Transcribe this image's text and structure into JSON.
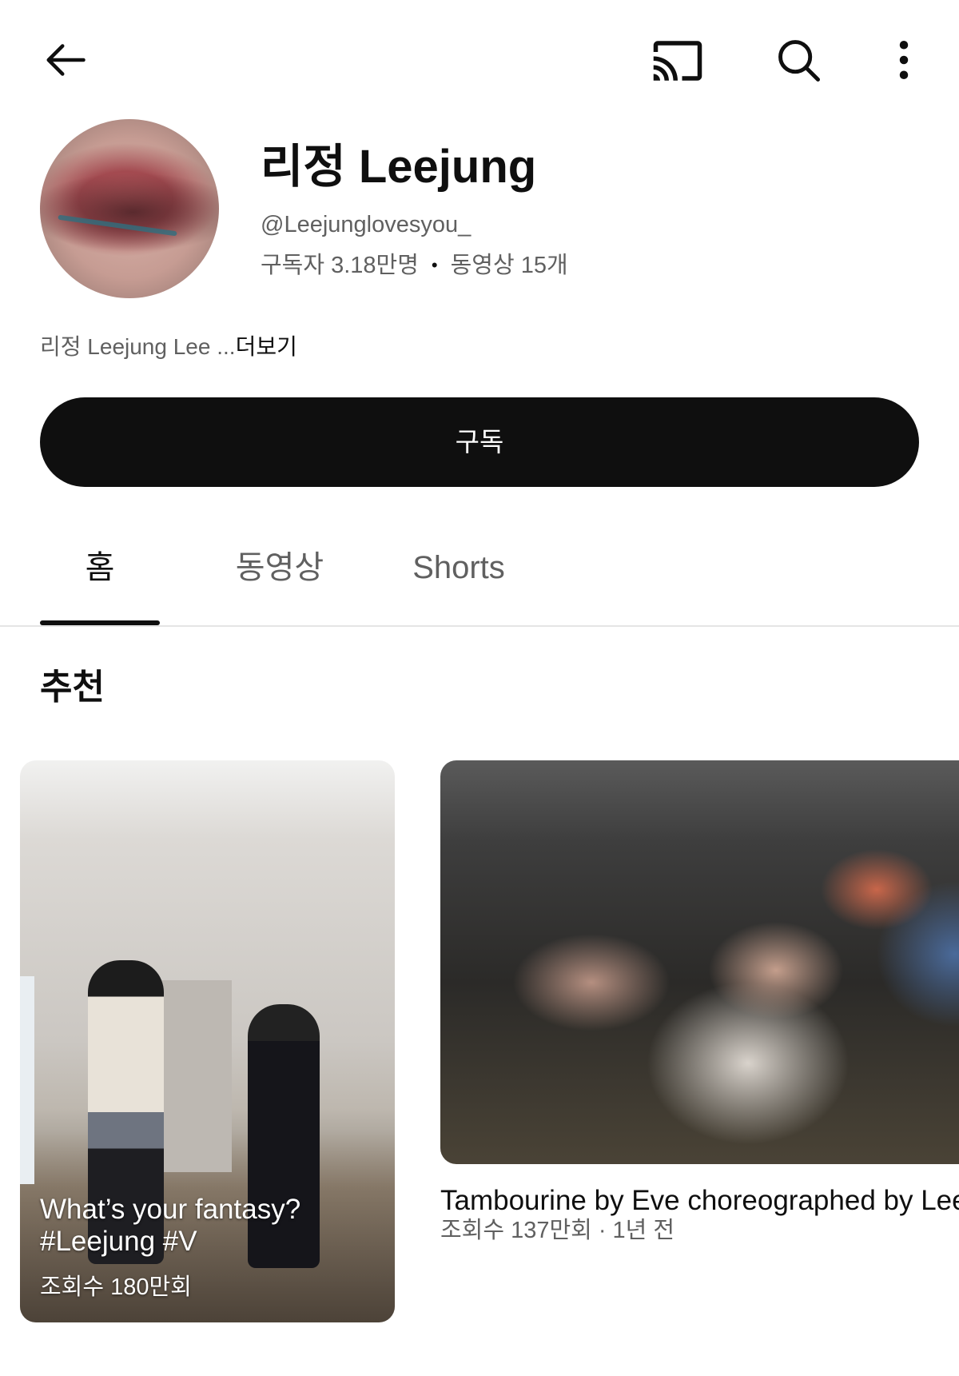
{
  "header": {
    "back_icon": "arrow-left-icon",
    "cast_icon": "cast-icon",
    "search_icon": "search-icon",
    "more_icon": "more-vert-icon"
  },
  "channel": {
    "name": "리정 Leejung",
    "handle": "@Leejunglovesyou_",
    "subscribers": "구독자 3.18만명",
    "stats_separator": "•",
    "videos": "동영상 15개",
    "description": "리정 Leejung Lee ...",
    "more_label": "더보기"
  },
  "subscribe": {
    "label": "구독"
  },
  "tabs": [
    {
      "label": "홈",
      "selected": true
    },
    {
      "label": "동영상",
      "selected": false
    },
    {
      "label": "Shorts",
      "selected": false
    }
  ],
  "featured": {
    "title": "추천",
    "items": [
      {
        "title_lines": [
          "What’s your fantasy?",
          "#Leejung #V"
        ],
        "views": "조회수 180만회"
      },
      {
        "title": "Tambourine by Eve choreographed by Leej",
        "views": "조회수 137만회",
        "meta_separator": "·",
        "age": "1년 전"
      }
    ]
  },
  "colors": {
    "text_primary": "#0f0f0f",
    "text_secondary": "#606060",
    "subscribe_bg": "#0f0f0f",
    "subscribe_text": "#ffffff",
    "divider": "#e5e5e5"
  }
}
